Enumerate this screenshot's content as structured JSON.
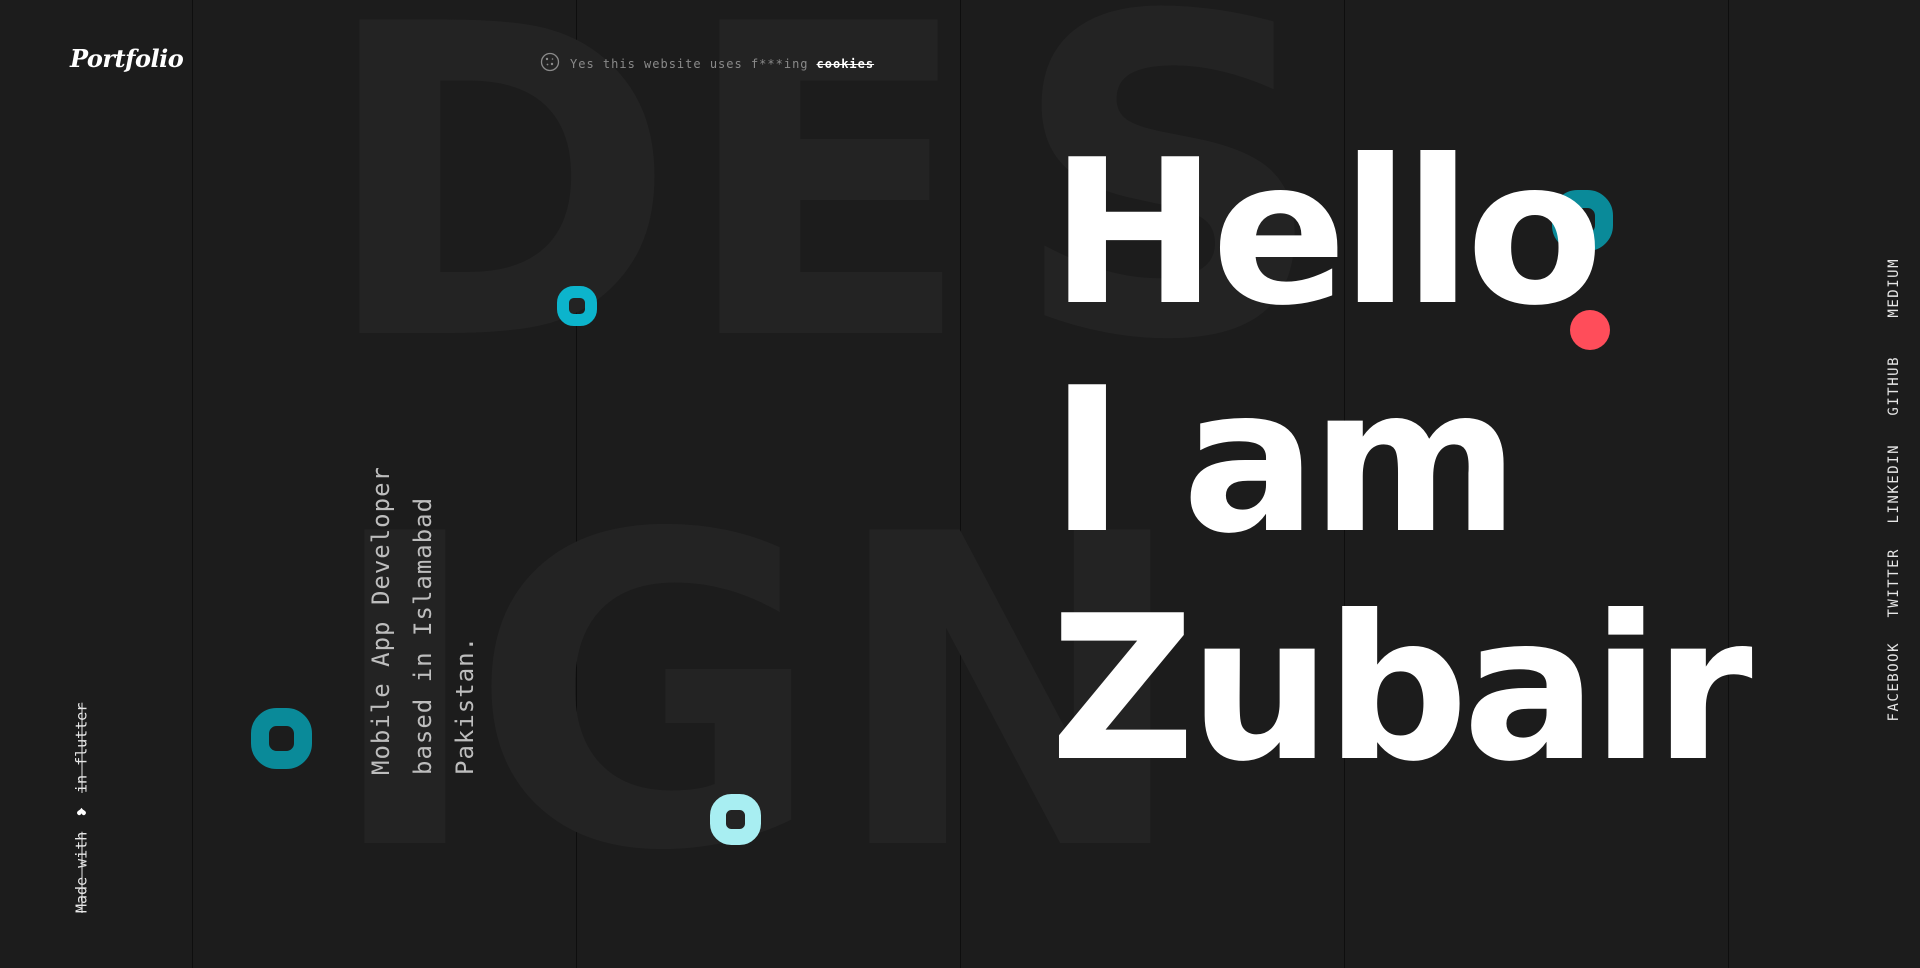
{
  "brand": {
    "logo_text": "Portfolio"
  },
  "cookie_notice": {
    "icon": "cookie-icon",
    "text": "Yes this website uses f***ing",
    "link_label": "cookies"
  },
  "background_word": {
    "letters": [
      "D",
      "E",
      "S",
      "I",
      "G",
      "N"
    ]
  },
  "tagline": "Mobile App Developer based in Islamabad Pakistan.",
  "footer_note": {
    "made_with": "Made with",
    "icon": "heart-icon",
    "in_flutter": "in flutter"
  },
  "hero": {
    "line1": "Hello",
    "line2": "I am",
    "line3": "Zubair"
  },
  "social_links": [
    "MEDIUM",
    "GITHUB",
    "LINKEDIN",
    "TWITTER",
    "FACEBOOK"
  ],
  "colors": {
    "background": "#1c1c1c",
    "accent_teal": "#0a8a99",
    "accent_cyan": "#0cb4cc",
    "accent_light_cyan": "#a8eef2",
    "accent_red": "#ff4d5a",
    "text_primary": "#ffffff"
  }
}
